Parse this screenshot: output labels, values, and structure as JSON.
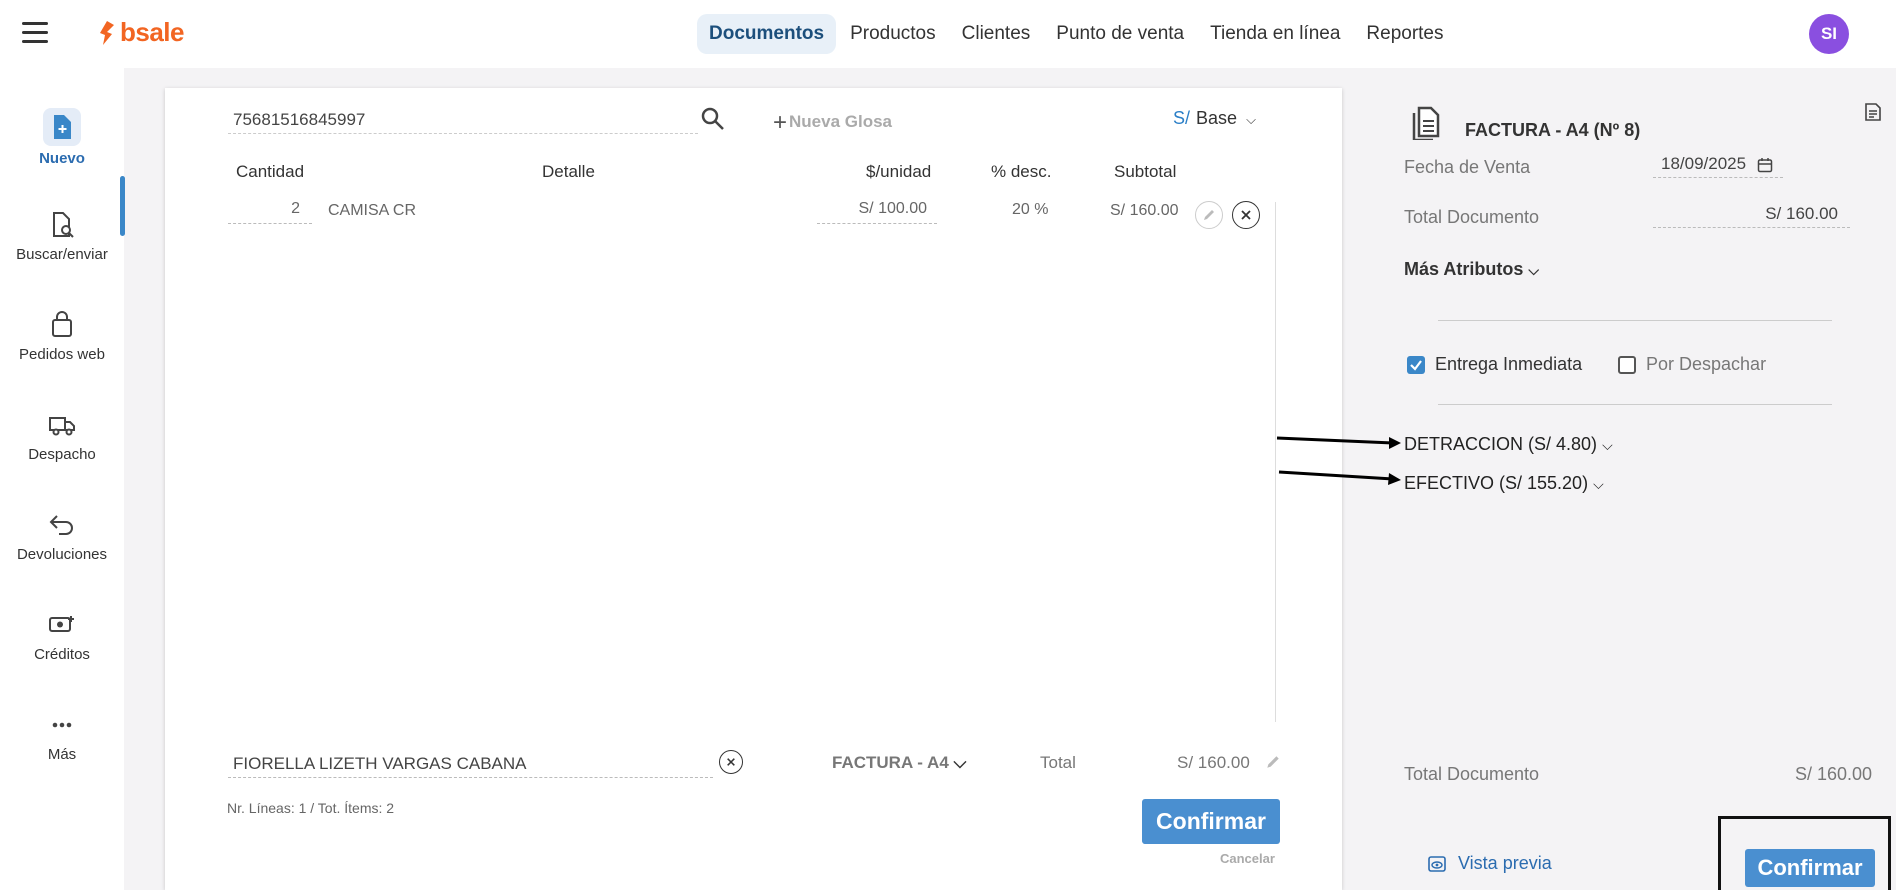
{
  "header": {
    "logo_text": "bsale",
    "nav": [
      "Documentos",
      "Productos",
      "Clientes",
      "Punto de venta",
      "Tienda en línea",
      "Reportes"
    ],
    "avatar_initials": "SI"
  },
  "sidebar": {
    "items": [
      {
        "label": "Nuevo",
        "icon": "new-document-icon"
      },
      {
        "label": "Buscar/enviar",
        "icon": "search-document-icon"
      },
      {
        "label": "Pedidos web",
        "icon": "shopping-bag-icon"
      },
      {
        "label": "Despacho",
        "icon": "truck-icon"
      },
      {
        "label": "Devoluciones",
        "icon": "return-arrow-icon"
      },
      {
        "label": "Créditos",
        "icon": "credit-card-icon"
      },
      {
        "label": "Más",
        "icon": "more-dots-icon"
      }
    ]
  },
  "document": {
    "search_value": "75681516845997",
    "nueva_glosa": "Nueva Glosa",
    "currency_symbol": "S/",
    "currency_base": "Base",
    "columns": [
      "Cantidad",
      "Detalle",
      "$/unidad",
      "% desc.",
      "Subtotal"
    ],
    "rows": [
      {
        "quantity": "2",
        "detail": "CAMISA CR",
        "unit_price": "S/ 100.00",
        "discount": "20 %",
        "subtotal": "S/ 160.00"
      }
    ],
    "client": "FIORELLA LIZETH VARGAS CABANA",
    "doc_type": "FACTURA - A4",
    "total_label": "Total",
    "total_value": "S/ 160.00",
    "summary": "Nr. Líneas: 1 / Tot. Ítems: 2",
    "confirm_label": "Confirmar",
    "cancel_label": "Cancelar"
  },
  "right_panel": {
    "title": "FACTURA - A4 (Nº 8)",
    "fecha_label": "Fecha de Venta",
    "fecha_value": "18/09/2025",
    "total_doc_label": "Total Documento",
    "total_doc_value": "S/ 160.00",
    "mas_atributos": "Más Atributos",
    "entrega_inmediata": "Entrega Inmediata",
    "entrega_inmediata_checked": true,
    "por_despachar": "Por Despachar",
    "por_despachar_checked": false,
    "detraccion": "DETRACCION (S/ 4.80)",
    "efectivo": "EFECTIVO (S/ 155.20)",
    "bottom_total_label": "Total Documento",
    "bottom_total_value": "S/ 160.00",
    "vista_previa": "Vista previa",
    "confirm_label": "Confirmar"
  },
  "colors": {
    "accent_blue": "#4a8fd0",
    "brand_orange": "#f26522",
    "avatar_purple": "#8a4fe0"
  }
}
